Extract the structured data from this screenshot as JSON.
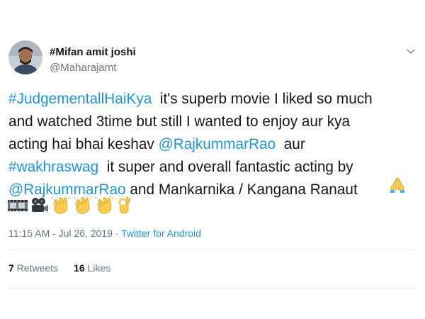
{
  "author": {
    "display_name": "#Mifan amit joshi",
    "handle": "@Maharajamt"
  },
  "tweet": {
    "lines": [
      [
        {
          "t": "#JudgementallHaiKya",
          "link": true
        },
        {
          "t": "  it's superb movie I liked so much",
          "link": false
        }
      ],
      [
        {
          "t": "and watched 3time but still I wanted to enjoy aur kya",
          "link": false
        }
      ],
      [
        {
          "t": "acting hai bhai keshav ",
          "link": false
        },
        {
          "t": "@RajkummarRao",
          "link": true
        },
        {
          "t": "  aur",
          "link": false
        }
      ],
      [
        {
          "t": "#wakhraswag",
          "link": true
        },
        {
          "t": "  it super and overall fantastic acting by",
          "link": false
        }
      ],
      [
        {
          "t": "@RajkummarRao",
          "link": true
        },
        {
          "t": " and Mankarnika / Kangana Ranaut",
          "link": false
        }
      ]
    ],
    "emojis": [
      "film-frames-icon",
      "movie-camera-icon",
      "clapping-hands-icon",
      "clapping-hands-icon",
      "clapping-hands-icon",
      "ok-hand-icon"
    ],
    "pray_emoji": "folded-hands-icon"
  },
  "meta": {
    "time": "11:15 AM",
    "separator": " - ",
    "date": "Jul 26, 2019",
    "dot": " · ",
    "source": "Twitter for Android"
  },
  "stats": {
    "retweets_count": "7",
    "retweets_label": " Retweets",
    "likes_count": "16",
    "likes_label": " Likes"
  },
  "colors": {
    "link": "#1b95e0",
    "text": "#14171a",
    "muted": "#657786",
    "emoji_yellow": "#ffcc4d"
  }
}
